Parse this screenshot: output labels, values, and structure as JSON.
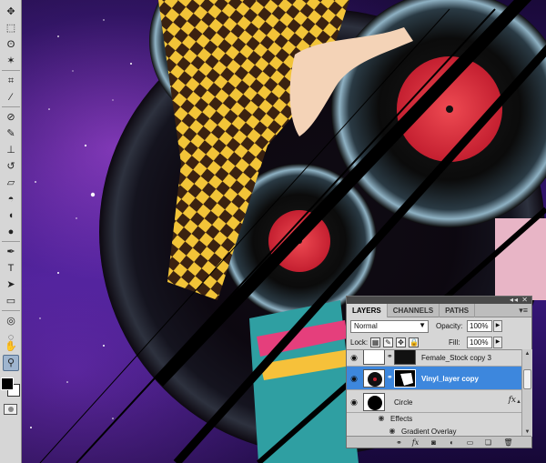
{
  "tools": [
    {
      "name": "move-tool-icon",
      "glyph": "✥"
    },
    {
      "name": "marquee-tool-icon",
      "glyph": "⬚"
    },
    {
      "name": "lasso-tool-icon",
      "glyph": "ʘ"
    },
    {
      "name": "magic-wand-tool-icon",
      "glyph": "✶"
    },
    {
      "name": "crop-tool-icon",
      "glyph": "⌗"
    },
    {
      "name": "eyedropper-tool-icon",
      "glyph": "⁄"
    },
    {
      "name": "healing-brush-tool-icon",
      "glyph": "⊘"
    },
    {
      "name": "brush-tool-icon",
      "glyph": "✎"
    },
    {
      "name": "clone-stamp-tool-icon",
      "glyph": "⊥"
    },
    {
      "name": "history-brush-tool-icon",
      "glyph": "↺"
    },
    {
      "name": "eraser-tool-icon",
      "glyph": "▱"
    },
    {
      "name": "paint-bucket-tool-icon",
      "glyph": "◓"
    },
    {
      "name": "blur-tool-icon",
      "glyph": "◖"
    },
    {
      "name": "dodge-tool-icon",
      "glyph": "●"
    },
    {
      "name": "pen-tool-icon",
      "glyph": "✒"
    },
    {
      "name": "type-tool-icon",
      "glyph": "T"
    },
    {
      "name": "path-selection-tool-icon",
      "glyph": "➤"
    },
    {
      "name": "shape-tool-icon",
      "glyph": "▭"
    },
    {
      "name": "3d-rotate-tool-icon",
      "glyph": "◎"
    },
    {
      "name": "3d-orbit-tool-icon",
      "glyph": "◌"
    },
    {
      "name": "hand-tool-icon",
      "glyph": "✋"
    },
    {
      "name": "zoom-tool-icon",
      "glyph": "⚲"
    }
  ],
  "active_tool": "zoom-tool-icon",
  "layers_panel": {
    "tabs": [
      "LAYERS",
      "CHANNELS",
      "PATHS"
    ],
    "blend_mode": "Normal",
    "opacity_label": "Opacity:",
    "opacity_value": "100%",
    "lock_label": "Lock:",
    "fill_label": "Fill:",
    "fill_value": "100%",
    "layers": [
      {
        "name": "Female_Stock copy 3",
        "selected": false,
        "has_mask": true
      },
      {
        "name": "Vinyl_layer copy",
        "selected": true,
        "has_mask": true
      },
      {
        "name": "Circle",
        "selected": false,
        "has_mask": false,
        "fx": "fx"
      }
    ],
    "effects_label": "Effects",
    "effect_items": [
      "Gradient Overlay"
    ],
    "bottom_icons": [
      "link-layers-icon",
      "fx-icon",
      "add-mask-icon",
      "adjustment-layer-icon",
      "new-group-icon",
      "new-layer-icon",
      "delete-layer-icon"
    ],
    "bottom_glyphs": [
      "⚭",
      "fx",
      "◙",
      "◐",
      "▭",
      "❏",
      "🗑"
    ]
  },
  "colors": {
    "selected_layer": "#3d87dd",
    "panel_bg": "#d6d6d6",
    "record_label_red": "#d8283a",
    "checker_yellow": "#f2c438",
    "checker_brown": "#3b2210"
  }
}
